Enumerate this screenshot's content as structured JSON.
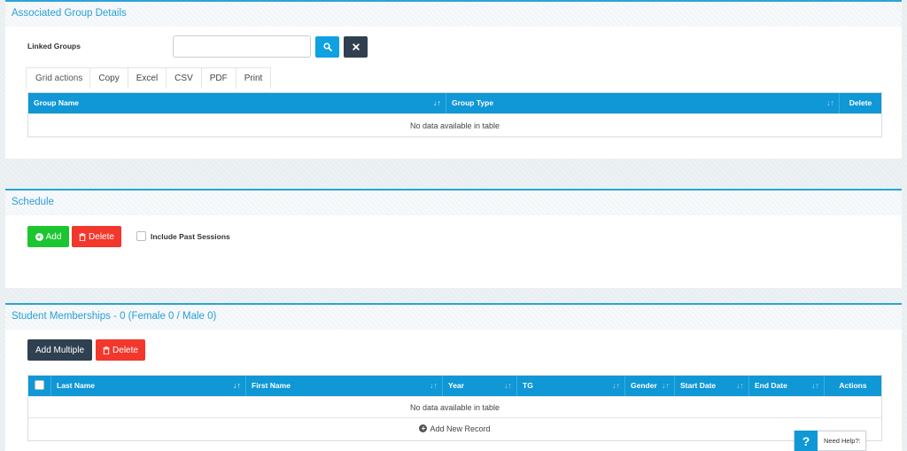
{
  "associated_group": {
    "title": "Associated Group Details",
    "linked_groups_label": "Linked Groups",
    "linked_groups_value": "",
    "search_icon": "search-icon",
    "clear_icon": "close-icon",
    "grid_actions": {
      "label": "Grid actions",
      "buttons": [
        "Copy",
        "Excel",
        "CSV",
        "PDF",
        "Print"
      ]
    },
    "table": {
      "columns": [
        "Group Name",
        "Group Type",
        "Delete"
      ],
      "empty_text": "No data available in table"
    }
  },
  "schedule": {
    "title": "Schedule",
    "add_label": "Add",
    "delete_label": "Delete",
    "include_past_label": "Include Past Sessions",
    "include_past_checked": false
  },
  "student_memberships": {
    "title": "Student Memberships - 0 (Female 0 / Male 0)",
    "add_multiple_label": "Add Multiple",
    "delete_label": "Delete",
    "table": {
      "columns": [
        "Last Name",
        "First Name",
        "Year",
        "TG",
        "Gender",
        "Start Date",
        "End Date",
        "Actions"
      ],
      "empty_text": "No data available in table",
      "add_new_label": "Add New Record"
    }
  },
  "help": {
    "icon": "?",
    "label": "Need Help?:"
  },
  "colors": {
    "accent": "#29a3d8",
    "table_header": "#0f97d6",
    "green": "#1cc630",
    "red": "#f2372c",
    "dark": "#2f4050"
  }
}
